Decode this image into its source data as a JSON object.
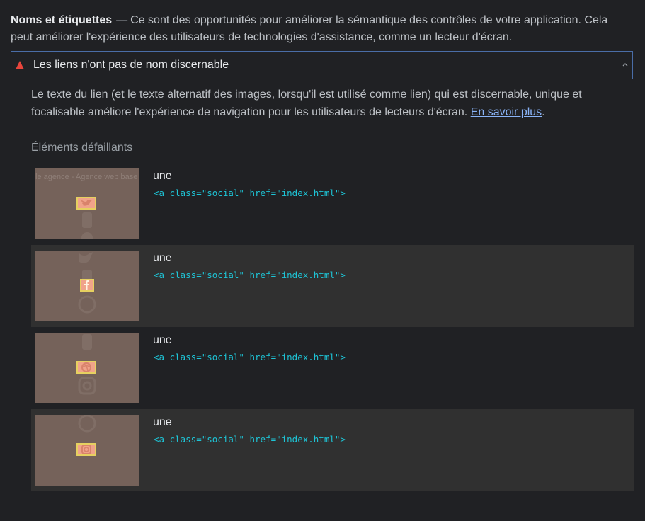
{
  "group": {
    "title": "Noms et étiquettes",
    "dash": "—",
    "description": "Ce sont des opportunités pour améliorer la sémantique des contrôles de votre application. Cela peut améliorer l'expérience des utilisateurs de technologies d'assistance, comme un lecteur d'écran."
  },
  "audit": {
    "title": "Les liens n'ont pas de nom discernable",
    "status_icon": "warning-triangle-icon",
    "status_color": "#e8453c",
    "description": "Le texte du lien (et le texte alternatif des images, lorsqu'il est utilisé comme lien) qui est discernable, unique et focalisable améliore l'expérience de navigation pour les utilisateurs de lecteurs d'écran. ",
    "learn_more": "En savoir plus",
    "trailing": ".",
    "failing_heading": "Éléments défaillants"
  },
  "items": [
    {
      "label": "une",
      "snippet": "<a class=\"social\" href=\"index.html\">",
      "thumb_text": "le agence - Agence web base"
    },
    {
      "label": "une",
      "snippet": "<a class=\"social\" href=\"index.html\">"
    },
    {
      "label": "une",
      "snippet": "<a class=\"social\" href=\"index.html\">"
    },
    {
      "label": "une",
      "snippet": "<a class=\"social\" href=\"index.html\">"
    }
  ],
  "colors": {
    "accent_link": "#8ab4f8",
    "code": "#1ec4d6",
    "highlight_border": "#e6d060"
  }
}
